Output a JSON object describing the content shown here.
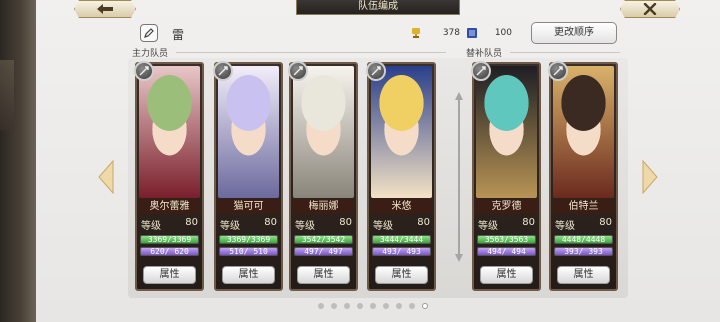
{
  "header": {
    "title": "队伍编成",
    "back_icon": "back-arrow-icon",
    "close_icon": "close-x-icon"
  },
  "team": {
    "name": "雷",
    "resource1_value": "378",
    "resource2_value": "100",
    "order_button": "更改顺序"
  },
  "sections": {
    "main_label": "主力队员",
    "reserve_label": "替补队员"
  },
  "colors": {
    "accent_gold": "#c9a86a",
    "hp_green": "#3aa83a",
    "mp_purple": "#7a55c9",
    "card_bg": "#2c221d"
  },
  "common": {
    "level_label": "等级",
    "attr_button": "属性"
  },
  "main_members": [
    {
      "name": "奥尔蕾雅",
      "level": "80",
      "hp": "3369/3369",
      "mp": "620/ 620",
      "hp_fill": 1.0,
      "mp_fill": 1.0,
      "palette": [
        "#9bbf7a",
        "#e8c7c8",
        "#7a1f2b"
      ]
    },
    {
      "name": "猫可可",
      "level": "80",
      "hp": "3369/3369",
      "mp": "510/ 510",
      "hp_fill": 1.0,
      "mp_fill": 1.0,
      "palette": [
        "#c9c2f0",
        "#f2eef9",
        "#6c6a9e"
      ]
    },
    {
      "name": "梅丽娜",
      "level": "80",
      "hp": "3542/3542",
      "mp": "497/ 497",
      "hp_fill": 1.0,
      "mp_fill": 1.0,
      "palette": [
        "#e9e6dc",
        "#f7f4ef",
        "#8a857a"
      ]
    },
    {
      "name": "米悠",
      "level": "80",
      "hp": "3444/3444",
      "mp": "493/ 493",
      "hp_fill": 1.0,
      "mp_fill": 1.0,
      "palette": [
        "#f0cf63",
        "#2a3f8c",
        "#f3e2c4"
      ]
    }
  ],
  "reserve_members": [
    {
      "name": "克罗德",
      "level": "80",
      "hp": "3563/3563",
      "mp": "494/ 494",
      "hp_fill": 1.0,
      "mp_fill": 1.0,
      "palette": [
        "#5fc7be",
        "#1e1e24",
        "#b89455"
      ]
    },
    {
      "name": "伯特兰",
      "level": "80",
      "hp": "4448/4448",
      "mp": "393/ 393",
      "hp_fill": 1.0,
      "mp_fill": 1.0,
      "palette": [
        "#3b2a22",
        "#d9b26a",
        "#6b2a1e"
      ]
    }
  ],
  "pagination": {
    "total": 9,
    "active": 8
  }
}
